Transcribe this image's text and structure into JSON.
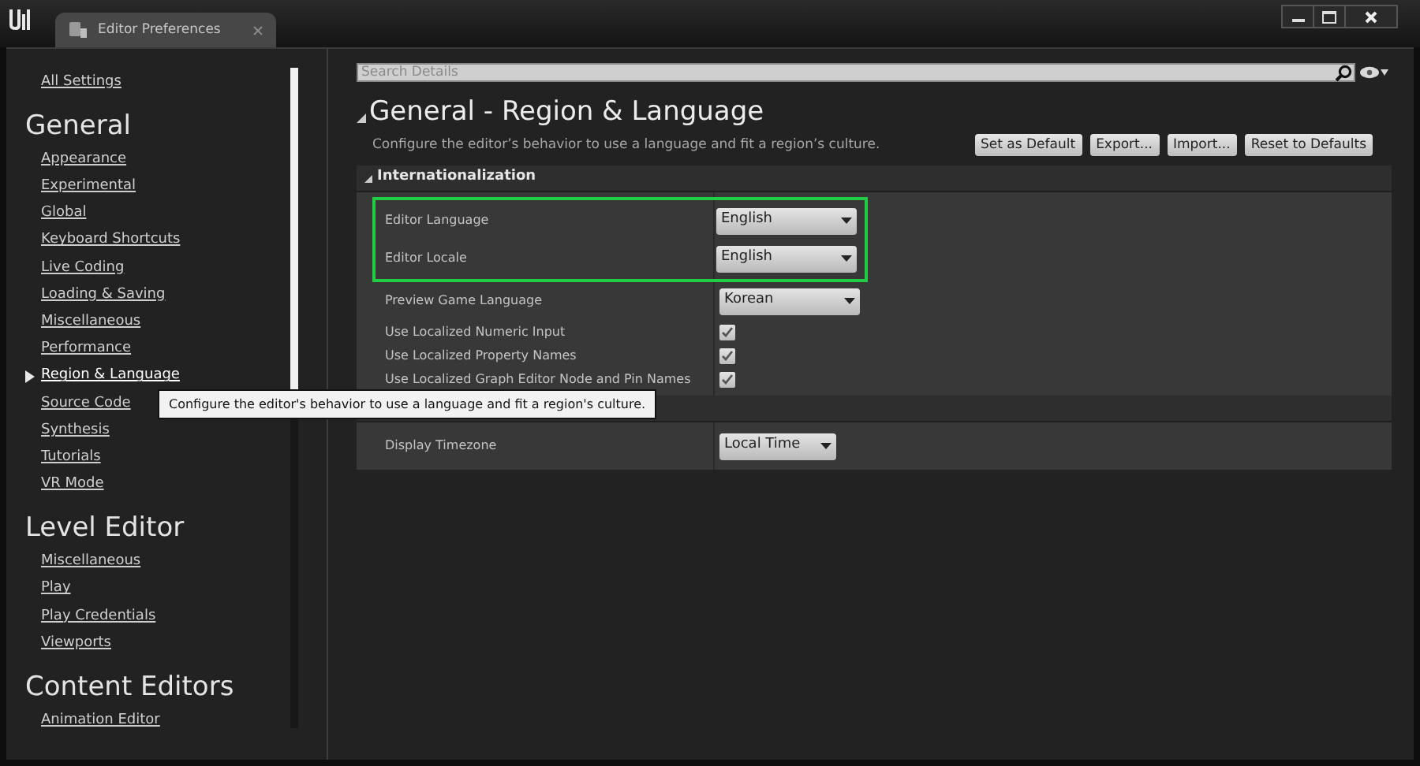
{
  "window": {
    "tab_title": "Editor Preferences"
  },
  "sidebar": {
    "all_settings": "All Settings",
    "sections": [
      {
        "title": "General",
        "items": [
          {
            "label": "Appearance",
            "selected": false
          },
          {
            "label": "Experimental",
            "selected": false
          },
          {
            "label": "Global",
            "selected": false
          },
          {
            "label": "Keyboard Shortcuts",
            "selected": false
          },
          {
            "label": "Live Coding",
            "selected": false
          },
          {
            "label": "Loading & Saving",
            "selected": false
          },
          {
            "label": "Miscellaneous",
            "selected": false
          },
          {
            "label": "Performance",
            "selected": false
          },
          {
            "label": "Region & Language",
            "selected": true
          },
          {
            "label": "Source Code",
            "selected": false
          },
          {
            "label": "Synthesis",
            "selected": false
          },
          {
            "label": "Tutorials",
            "selected": false
          },
          {
            "label": "VR Mode",
            "selected": false
          }
        ]
      },
      {
        "title": "Level Editor",
        "items": [
          {
            "label": "Miscellaneous",
            "selected": false
          },
          {
            "label": "Play",
            "selected": false
          },
          {
            "label": "Play Credentials",
            "selected": false
          },
          {
            "label": "Viewports",
            "selected": false
          }
        ]
      },
      {
        "title": "Content Editors",
        "items": [
          {
            "label": "Animation Editor",
            "selected": false
          }
        ]
      }
    ]
  },
  "search": {
    "placeholder": "Search Details"
  },
  "page": {
    "title": "General - Region & Language",
    "description": "Configure the editor’s behavior to use a language and fit a region’s culture.",
    "buttons": [
      "Set as Default",
      "Export...",
      "Import...",
      "Reset to Defaults"
    ]
  },
  "categories": [
    {
      "title": "Internationalization",
      "expanded": true,
      "properties": [
        {
          "kind": "combo",
          "label": "Editor Language",
          "value": "English",
          "highlighted": true
        },
        {
          "kind": "combo",
          "label": "Editor Locale",
          "value": "English",
          "highlighted": true
        },
        {
          "kind": "combo",
          "label": "Preview Game Language",
          "value": "Korean",
          "highlighted": false
        },
        {
          "kind": "checkbox",
          "label": "Use Localized Numeric Input",
          "checked": true,
          "highlighted": false
        },
        {
          "kind": "checkbox",
          "label": "Use Localized Property Names",
          "checked": true,
          "highlighted": false
        },
        {
          "kind": "checkbox",
          "label": "Use Localized Graph Editor Node and Pin Names",
          "checked": true,
          "highlighted": false
        }
      ]
    },
    {
      "properties": [
        {
          "kind": "smallcombo",
          "label": "Display Timezone",
          "value": "Local Time",
          "highlighted": false
        }
      ]
    }
  ],
  "tooltip": "Configure the editor's behavior to use a language and fit a region's culture."
}
